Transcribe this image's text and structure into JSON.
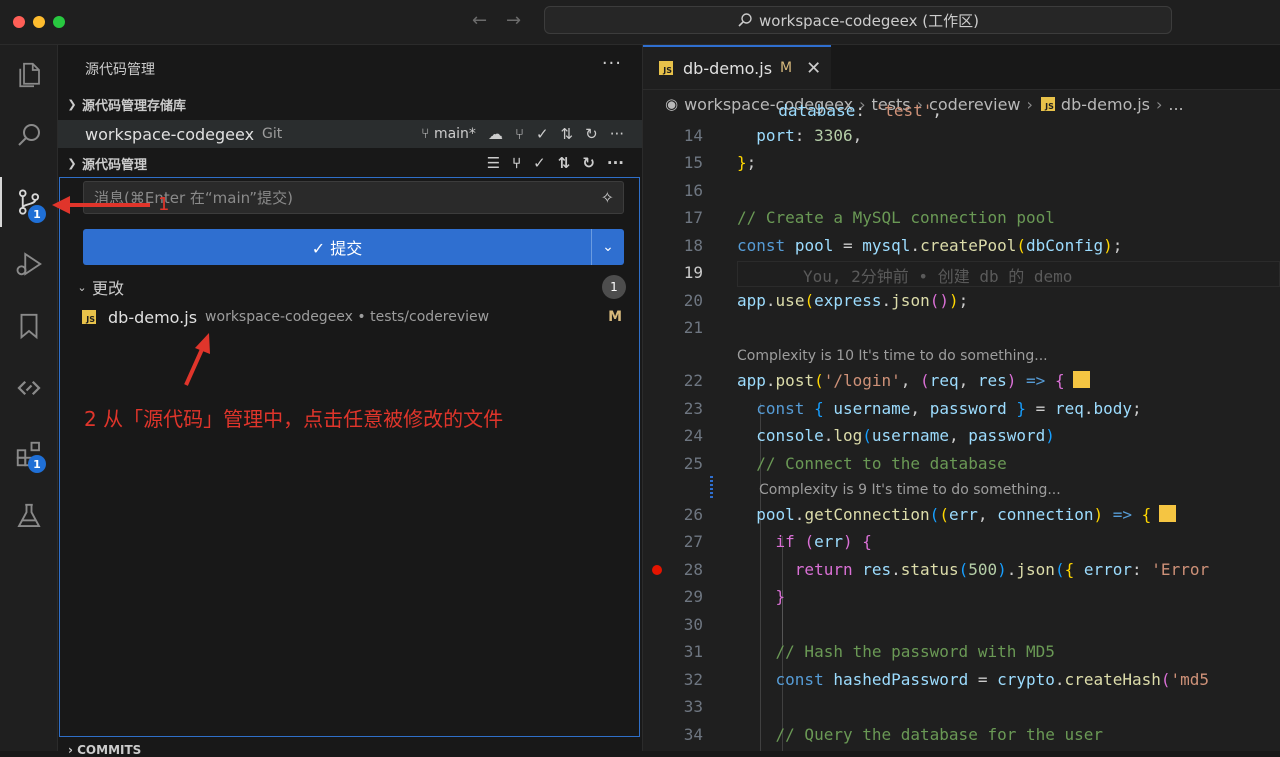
{
  "titlebar": {
    "command_center": "workspace-codegeex (工作区)",
    "traffic_colors": [
      "#ff5f57",
      "#febc2e",
      "#28c840"
    ]
  },
  "activity_bar": {
    "items": [
      {
        "name": "explorer",
        "icon": "files-icon"
      },
      {
        "name": "search",
        "icon": "search-icon"
      },
      {
        "name": "source-control",
        "icon": "source-control-icon",
        "badge": "1",
        "active": true
      },
      {
        "name": "run-debug",
        "icon": "debug-icon"
      },
      {
        "name": "bookmarks",
        "icon": "bookmark-icon"
      },
      {
        "name": "codegeex",
        "icon": "codegeex-icon"
      },
      {
        "name": "extensions",
        "icon": "extensions-icon",
        "badge": "1"
      },
      {
        "name": "testing",
        "icon": "flask-icon"
      }
    ]
  },
  "sidebar": {
    "title": "源代码管理",
    "more": "···",
    "repos_header": "源代码管理存储库",
    "repo": {
      "name": "workspace-codegeex",
      "kind": "Git",
      "branch": "main*"
    },
    "scm_header": "源代码管理",
    "commit_input_placeholder": "消息(⌘Enter 在“main”提交)",
    "commit_button": "✓ 提交",
    "changes": {
      "label": "更改",
      "count": "1"
    },
    "file": {
      "name": "db-demo.js",
      "path": "workspace-codegeex • tests/codereview",
      "status": "M"
    },
    "commits_header": "COMMITS"
  },
  "annotations": {
    "step1": "1",
    "step2": "2 从「源代码」管理中，点击任意被修改的文件",
    "color": "#e0352b"
  },
  "editor": {
    "tab": {
      "label": "db-demo.js",
      "modified": "M",
      "close": "✕"
    },
    "breadcrumbs": [
      "workspace-codegeex",
      "tests",
      "codereview",
      "db-demo.js",
      "..."
    ],
    "lens_1": "Complexity is 10 It's time to do something...",
    "lens_2": "Complexity is 9 It's time to do something...",
    "ghost_blame": "You, 2分钟前 • 创建 db 的 demo",
    "line_numbers": [
      "14",
      "15",
      "16",
      "17",
      "18",
      "19",
      "20",
      "21",
      "22",
      "23",
      "24",
      "25",
      "26",
      "27",
      "28",
      "29",
      "30",
      "31",
      "32",
      "33",
      "34"
    ]
  },
  "colors": {
    "accent": "#2f6fd0",
    "modified": "#d7b97c",
    "badge": "#1f6fd6"
  }
}
